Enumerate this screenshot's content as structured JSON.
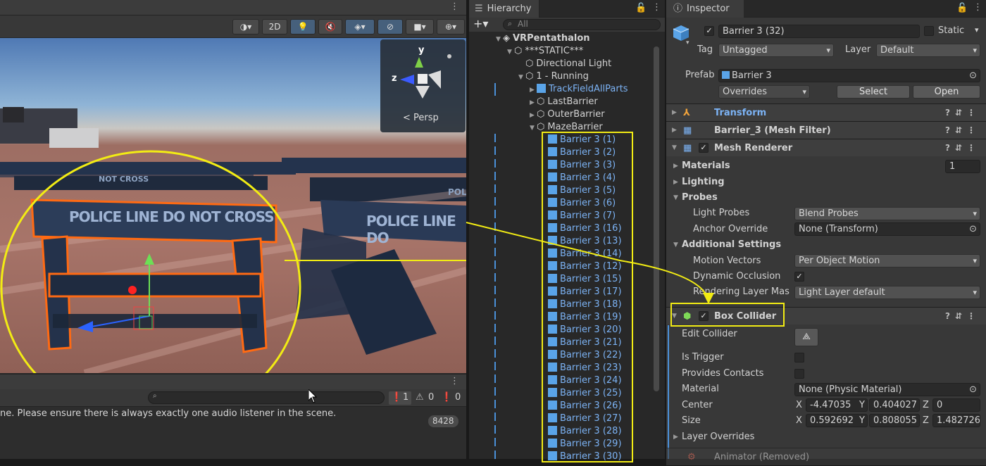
{
  "scene": {
    "toolbar": {
      "mode_2d": "2D"
    },
    "gizmo": {
      "y_axis": "y",
      "z_axis": "z",
      "persp_label": "< Persp"
    },
    "barrier_text_1": "POLICE LINE DO NOT CROSS",
    "barrier_text_2": "POLICE LINE DO",
    "barrier_text_3": "NOT CROSS",
    "barrier_text_4": "POLI"
  },
  "console": {
    "search_placeholder": "",
    "errors_count": "1",
    "warnings_count": "0",
    "logs_count": "0",
    "message": "ne. Please ensure there is always exactly one audio listener in the scene.",
    "message_count": "8428"
  },
  "hierarchy": {
    "tab_title": "Hierarchy",
    "search_placeholder": "All",
    "root": "VRPentathalon",
    "static_group": "***STATIC***",
    "items": [
      {
        "label": "Directional Light"
      },
      {
        "label": "1 - Running"
      },
      {
        "label": "TrackFieldAllParts"
      },
      {
        "label": "LastBarrier"
      },
      {
        "label": "OuterBarrier"
      },
      {
        "label": "MazeBarrier"
      }
    ],
    "barriers": [
      "Barrier 3 (1)",
      "Barrier 3 (2)",
      "Barrier 3 (3)",
      "Barrier 3 (4)",
      "Barrier 3 (5)",
      "Barrier 3 (6)",
      "Barrier 3 (7)",
      "Barrier 3 (16)",
      "Barrier 3 (13)",
      "Barrier 3 (14)",
      "Barrier 3 (12)",
      "Barrier 3 (15)",
      "Barrier 3 (17)",
      "Barrier 3 (18)",
      "Barrier 3 (19)",
      "Barrier 3 (20)",
      "Barrier 3 (21)",
      "Barrier 3 (22)",
      "Barrier 3 (23)",
      "Barrier 3 (24)",
      "Barrier 3 (25)",
      "Barrier 3 (26)",
      "Barrier 3 (27)",
      "Barrier 3 (28)",
      "Barrier 3 (29)",
      "Barrier 3 (30)"
    ]
  },
  "inspector": {
    "tab_title": "Inspector",
    "object_name": "Barrier 3 (32)",
    "static_label": "Static",
    "tag_label": "Tag",
    "tag_value": "Untagged",
    "layer_label": "Layer",
    "layer_value": "Default",
    "prefab_label": "Prefab",
    "prefab_value": "Barrier 3",
    "overrides": "Overrides",
    "select": "Select",
    "open": "Open",
    "transform": "Transform",
    "mesh_filter": "Barrier_3 (Mesh Filter)",
    "mesh_renderer": "Mesh Renderer",
    "materials": "Materials",
    "materials_count": "1",
    "lighting": "Lighting",
    "probes": "Probes",
    "light_probes_label": "Light Probes",
    "light_probes_value": "Blend Probes",
    "anchor_override_label": "Anchor Override",
    "anchor_override_value": "None (Transform)",
    "additional_settings": "Additional Settings",
    "motion_vectors_label": "Motion Vectors",
    "motion_vectors_value": "Per Object Motion",
    "dynamic_occlusion_label": "Dynamic Occlusion",
    "rendering_layer_label": "Rendering Layer Mas",
    "rendering_layer_value": "Light Layer default",
    "box_collider": "Box Collider",
    "edit_collider": "Edit Collider",
    "is_trigger": "Is Trigger",
    "provides_contacts": "Provides Contacts",
    "material_label": "Material",
    "material_value": "None (Physic Material)",
    "center_label": "Center",
    "center_x": "-4.47035",
    "center_y": "0.404027",
    "center_z": "0",
    "size_label": "Size",
    "size_x": "0.592692",
    "size_y": "0.808055",
    "size_z": "1.482726",
    "x": "X",
    "y": "Y",
    "z": "Z",
    "layer_overrides": "Layer Overrides",
    "animator": "Animator (Removed)"
  },
  "colors": {
    "highlight": "#f2ec14",
    "selection_blue": "#7cb3f5",
    "accent": "#46607c"
  }
}
